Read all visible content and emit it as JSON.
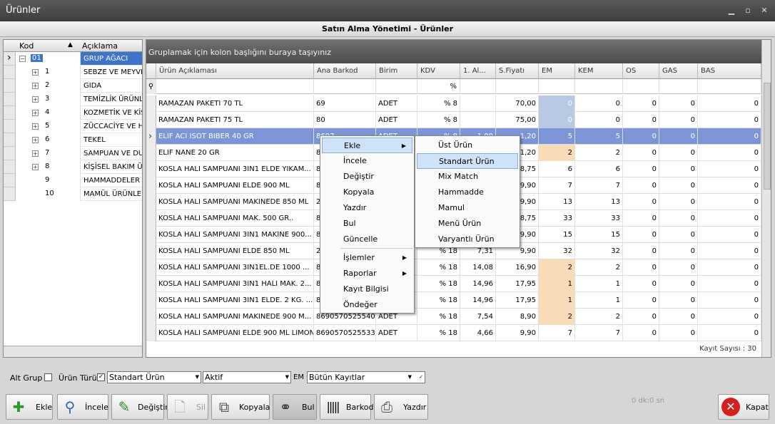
{
  "window": {
    "title": "Ürünler",
    "subtitle": "Satın Alma Yönetimi - Ürünler"
  },
  "tree": {
    "columns": [
      "Kod",
      "Açıklama"
    ],
    "items": [
      {
        "kod": "01",
        "aciklama": "GRUP AĞACI",
        "level": 0,
        "selected": true
      },
      {
        "kod": "1",
        "aciklama": "SEBZE VE MEYVEL",
        "level": 1
      },
      {
        "kod": "2",
        "aciklama": "GIDA",
        "level": 1
      },
      {
        "kod": "3",
        "aciklama": "TEMİZLİK ÜRÜNLE",
        "level": 1
      },
      {
        "kod": "4",
        "aciklama": "KOZMETİK VE KİŞ",
        "level": 1
      },
      {
        "kod": "5",
        "aciklama": "ZÜCCACİYE VE Hİ",
        "level": 1
      },
      {
        "kod": "6",
        "aciklama": "TEKEL",
        "level": 1
      },
      {
        "kod": "7",
        "aciklama": "SAMPUAN VE DUS",
        "level": 1
      },
      {
        "kod": "8",
        "aciklama": "KİŞİSEL BAKIM Ü.",
        "level": 1
      },
      {
        "kod": "9",
        "aciklama": "HAMMADDELER",
        "level": 1,
        "leaf": true
      },
      {
        "kod": "10",
        "aciklama": "MAMÜL ÜRÜNLER",
        "level": 1,
        "leaf": true
      }
    ]
  },
  "grid": {
    "group_hint": "Gruplamak için kolon başlığını buraya taşıyınız",
    "columns": [
      "Ürün Açıklaması",
      "Ana Barkod",
      "Birim",
      "KDV",
      "1. Al...",
      "S.Fiyatı",
      "EM",
      "KEM",
      "OS",
      "GAS",
      "BAS"
    ],
    "filter_kdv": "%",
    "rows": [
      [
        "RAMAZAN PAKETI 70 TL",
        "69",
        "ADET",
        "% 8",
        "",
        "70,00",
        "0",
        "0",
        "0",
        "0",
        "0"
      ],
      [
        "RAMAZAN PAKETI 75 TL",
        "80",
        "ADET",
        "% 8",
        "",
        "75,00",
        "0",
        "0",
        "0",
        "0",
        "0"
      ],
      [
        "ELIF ACI ISOT BIBER 40 GR",
        "8697... ",
        "ADET",
        "% 8",
        "1,00",
        "1,20",
        "5",
        "5",
        "0",
        "0",
        "0"
      ],
      [
        "ELIF NANE 20 GR",
        "8",
        "",
        "",
        "",
        "1,20",
        "2",
        "2",
        "0",
        "0",
        "0"
      ],
      [
        "KOSLA HALI SAMPUANI 3IN1 ELDE YIKAM...",
        "8",
        "",
        "",
        "",
        "8,75",
        "6",
        "6",
        "0",
        "0",
        "0"
      ],
      [
        "KOSLA HALI SAMPUANI ELDE 900 ML",
        "8",
        "",
        "",
        "",
        "9,90",
        "7",
        "7",
        "0",
        "0",
        "0"
      ],
      [
        "KOSLA HALI SAMPUANI MAKINEDE 850 ML",
        "2",
        "",
        "",
        "",
        "9,90",
        "13",
        "13",
        "0",
        "0",
        "0"
      ],
      [
        "KOSLA HALI SAMPUANI MAK. 500 GR..",
        "8",
        "",
        "",
        "",
        "8,75",
        "33",
        "33",
        "0",
        "0",
        "0"
      ],
      [
        "KOSLA HALI SAMPUANI 3IN1 MAKINE 900...",
        "8",
        "",
        "",
        "",
        "9,90",
        "15",
        "15",
        "0",
        "0",
        "0"
      ],
      [
        "KOSLA HALI SAMPUANI ELDE 850 ML",
        "2",
        "",
        "% 18",
        "7,31",
        "9,90",
        "32",
        "32",
        "0",
        "0",
        "0"
      ],
      [
        "KOSLA HALI SAMPUANI 3IN1EL.DE 1000 ...",
        "8",
        "",
        "% 18",
        "14,08",
        "16,90",
        "2",
        "2",
        "0",
        "0",
        "0"
      ],
      [
        "KOSLA HALI SAMPUANI 3IN1 HALI MAK. 2...",
        "8",
        "",
        "% 18",
        "14,96",
        "17,95",
        "1",
        "1",
        "0",
        "0",
        "0"
      ],
      [
        "KOSLA HALI SAMPUANI 3IN1 ELDE. 2 KG. ...",
        "8",
        "",
        "% 18",
        "14,96",
        "17,95",
        "1",
        "1",
        "0",
        "0",
        "0"
      ],
      [
        "KOSLA HALI SAMPUANI MAKINEDE 900 M...",
        "8690570525540",
        "ADET",
        "% 18",
        "7,54",
        "8,90",
        "2",
        "2",
        "0",
        "0",
        "0"
      ],
      [
        "KOSLA HALI SAMPUANI ELDE 900 ML LIMON",
        "8690570525533",
        "ADET",
        "% 18",
        "4,66",
        "9,90",
        "7",
        "7",
        "0",
        "0",
        "0"
      ]
    ],
    "em_highlight": {
      "blue": [
        0,
        1
      ],
      "orange": [
        3,
        10,
        11,
        12,
        13
      ]
    },
    "record_count": "Kayıt Sayısı : 30"
  },
  "context_menu": {
    "items": [
      "Ekle",
      "İncele",
      "Değiştir",
      "Kopyala",
      "Yazdır",
      "Bul",
      "Güncelle",
      "İşlemler",
      "Raporlar",
      "Kayıt Bilgisi",
      "Öndeğer"
    ]
  },
  "submenu": {
    "items": [
      "Üst Ürün",
      "Standart Ürün",
      "Mix Match",
      "Hammadde",
      "Mamul",
      "Menü Ürün",
      "Varyantlı Ürün"
    ]
  },
  "filters": {
    "alt_grup": "Alt Grup",
    "urun_turu": "Ürün Türü",
    "urun_turu_value": "Standart Ürün",
    "status_value": "Aktif",
    "em_label": "EM",
    "records_value": "Bütün Kayıtlar"
  },
  "toolbar": {
    "ekle": "Ekle",
    "incele": "İncele",
    "degistir": "Değiştir",
    "sil": "Sil",
    "kopyala": "Kopyala",
    "bul": "Bul",
    "barkod": "Barkod",
    "yazdir": "Yazdır",
    "kapat": "Kapat",
    "status": "0 dk:0 sn"
  }
}
